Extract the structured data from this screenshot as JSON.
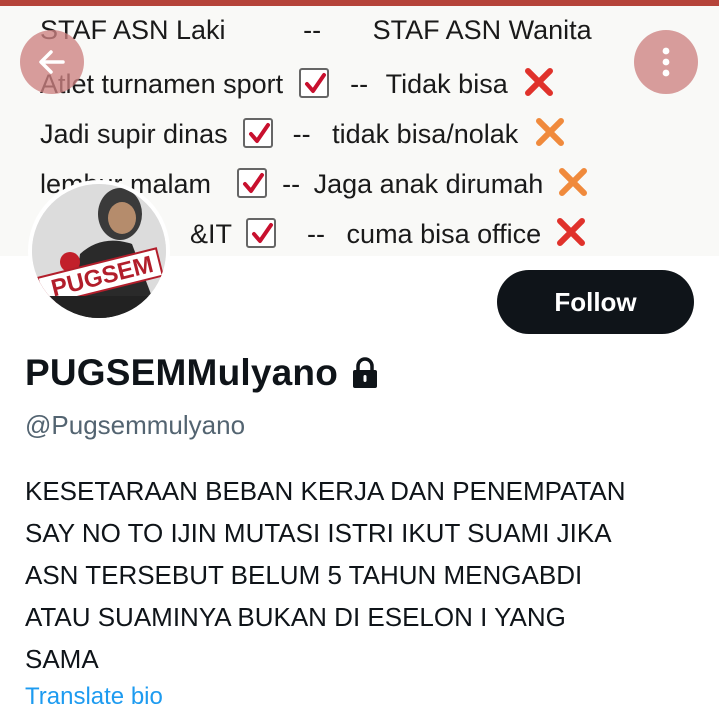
{
  "banner": {
    "lines": [
      {
        "left": "STAF ASN Laki",
        "mid": "--",
        "right": "STAF ASN Wanita",
        "check": false,
        "cross": false
      },
      {
        "left": "Atlet turnamen sport",
        "mid": "--",
        "right": "Tidak bisa",
        "check": true,
        "cross": true
      },
      {
        "left": "Jadi supir dinas",
        "mid": "--",
        "right": "tidak bisa/nolak",
        "check": true,
        "cross": true
      },
      {
        "left": "lembur malam",
        "mid": "--",
        "right": "Jaga anak dirumah",
        "check": true,
        "cross": true
      },
      {
        "left": "&IT",
        "mid": "--",
        "right": "cuma bisa office",
        "check": true,
        "cross": true
      }
    ]
  },
  "profile": {
    "name": "PUGSEMMulyano",
    "handle": "@Pugsemmulyano",
    "avatar_text": "PUGSEM",
    "follow_label": "Follow",
    "bio_lines": [
      "KESETARAAN BEBAN KERJA DAN PENEMPATAN",
      "SAY NO TO IJIN MUTASI ISTRI IKUT SUAMI JIKA",
      "ASN TERSEBUT BELUM 5 TAHUN MENGABDI",
      "ATAU SUAMINYA BUKAN DI ESELON I YANG",
      "SAMA"
    ],
    "translate_label": "Translate bio"
  },
  "icons": {
    "back": "back-arrow-icon",
    "more": "more-vertical-icon",
    "lock": "lock-icon",
    "check": "checkbox-check-icon",
    "cross": "red-cross-icon"
  },
  "colors": {
    "follow_bg": "#0f1419",
    "link": "#1d9bf0",
    "handle": "#536471",
    "nav_button": "#cd8282",
    "top_strip": "#b5443a"
  }
}
